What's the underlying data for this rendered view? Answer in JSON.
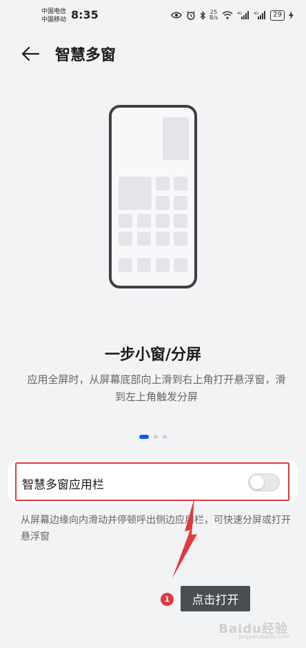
{
  "status_bar": {
    "carrier_1": "中国电信",
    "carrier_2": "中国移动",
    "time": "8:35",
    "net_speed_value": "25",
    "net_speed_unit": "B/s",
    "signal_1_label": "4G",
    "signal_2_label": "4G",
    "battery": "29"
  },
  "header": {
    "title": "智慧多窗"
  },
  "feature": {
    "title": "一步小窗/分屏",
    "description": "应用全屏时，从屏幕底部向上滑到右上角打开悬浮窗，滑到左上角触发分屏",
    "pages": 3,
    "current_page": 1
  },
  "setting": {
    "label": "智慧多窗应用栏",
    "enabled": false,
    "description": "从屏幕边缘向内滑动并停顿呼出侧边应用栏，可快速分屏或打开悬浮窗"
  },
  "annotation": {
    "step_number": "1",
    "tooltip": "点击打开"
  },
  "watermark": {
    "text": "Baidu经验",
    "sub": "jingyan.baidu.com"
  },
  "colors": {
    "background": "#f1f3f5",
    "accent": "#0a59f7",
    "highlight": "#e0393e",
    "tooltip_bg": "#4a4d51"
  }
}
